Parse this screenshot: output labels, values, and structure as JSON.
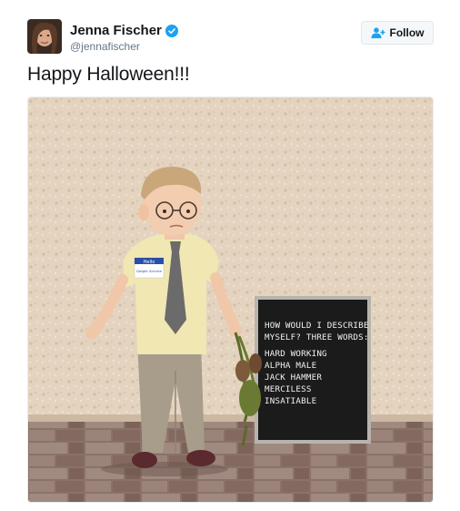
{
  "header": {
    "display_name": "Jenna Fischer",
    "handle": "@jennafischer",
    "verified": true,
    "follow_label": "Follow",
    "accent_color": "#1da1f2"
  },
  "tweet": {
    "text": "Happy Halloween!!!"
  },
  "photo": {
    "board_lines": [
      "HOW WOULD I DESCRIBE",
      "MYSELF? THREE WORDS:",
      "HARD WORKING",
      "ALPHA MALE",
      "JACK HAMMER",
      "MERCILESS",
      "INSATIABLE"
    ],
    "name_tag_header": "Hello",
    "name_tag_name": "Dwight Schrute"
  }
}
